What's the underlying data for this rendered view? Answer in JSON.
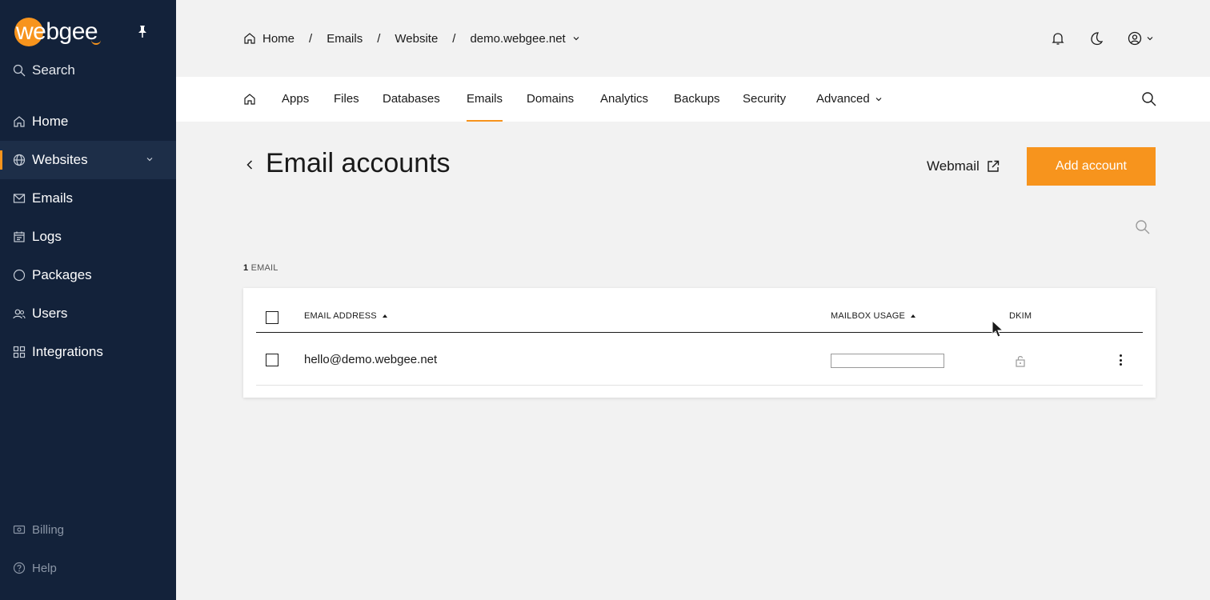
{
  "app": {
    "brand": "webgee",
    "accent": "#f7941d",
    "sidebar_bg": "#13223a"
  },
  "sidebar": {
    "search_label": "Search",
    "items": [
      {
        "label": "Home",
        "icon": "home-icon"
      },
      {
        "label": "Websites",
        "icon": "globe-icon",
        "active": true,
        "expandable": true
      },
      {
        "label": "Emails",
        "icon": "mail-icon"
      },
      {
        "label": "Logs",
        "icon": "calendar-icon"
      },
      {
        "label": "Packages",
        "icon": "circle-icon"
      },
      {
        "label": "Users",
        "icon": "users-icon"
      },
      {
        "label": "Integrations",
        "icon": "grid-icon"
      }
    ],
    "footer": [
      {
        "label": "Billing",
        "icon": "billing-icon"
      },
      {
        "label": "Help",
        "icon": "help-icon"
      }
    ]
  },
  "breadcrumb": {
    "items": [
      "Home",
      "Emails",
      "Website",
      "demo.webgee.net"
    ],
    "separator": "/"
  },
  "tabs": {
    "items": [
      "Apps",
      "Files",
      "Databases",
      "Emails",
      "Domains",
      "Analytics",
      "Backups",
      "Security",
      "Advanced"
    ],
    "active": "Emails"
  },
  "page": {
    "title": "Email accounts",
    "webmail_label": "Webmail",
    "add_button_label": "Add account",
    "count_number": "1",
    "count_label": "EMAIL"
  },
  "table": {
    "columns": [
      "EMAIL ADDRESS",
      "MAILBOX USAGE",
      "DKIM"
    ],
    "rows": [
      {
        "email": "hello@demo.webgee.net",
        "usage_fraction": 0,
        "dkim": "unlocked"
      }
    ]
  }
}
